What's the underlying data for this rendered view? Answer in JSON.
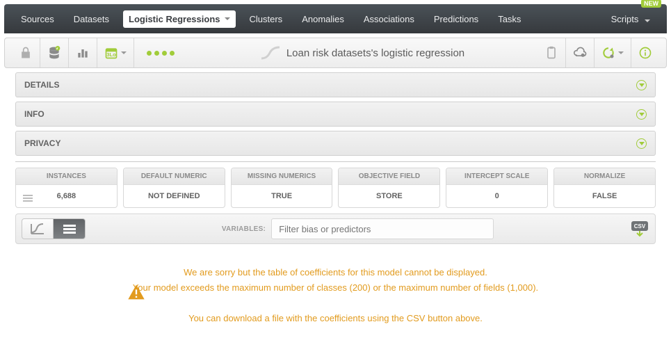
{
  "nav": {
    "sources": "Sources",
    "datasets": "Datasets",
    "logistic": "Logistic Regressions",
    "clusters": "Clusters",
    "anomalies": "Anomalies",
    "associations": "Associations",
    "predictions": "Predictions",
    "tasks": "Tasks",
    "scripts": "Scripts",
    "new_badge": "NEW"
  },
  "title": "Loan risk datasets's logistic regression",
  "sections": {
    "details": "DETAILS",
    "info": "INFO",
    "privacy": "PRIVACY"
  },
  "stats": {
    "instances": {
      "label": "INSTANCES",
      "value": "6,688"
    },
    "default_numeric": {
      "label": "DEFAULT NUMERIC",
      "value": "NOT DEFINED"
    },
    "missing_numerics": {
      "label": "MISSING NUMERICS",
      "value": "TRUE"
    },
    "objective_field": {
      "label": "OBJECTIVE FIELD",
      "value": "STORE"
    },
    "intercept_scale": {
      "label": "INTERCEPT SCALE",
      "value": "0"
    },
    "normalize": {
      "label": "NORMALIZE",
      "value": "FALSE"
    }
  },
  "viewbar": {
    "variables_label": "VARIABLES:",
    "filter_placeholder": "Filter bias or predictors"
  },
  "warning": {
    "line1": "We are sorry but the table of coefficients for this model cannot be displayed.",
    "line2": "Your model exceeds the maximum number of classes (200) or the maximum number of fields (1,000).",
    "line3": "You can download a file with the coefficients using the CSV button above."
  }
}
